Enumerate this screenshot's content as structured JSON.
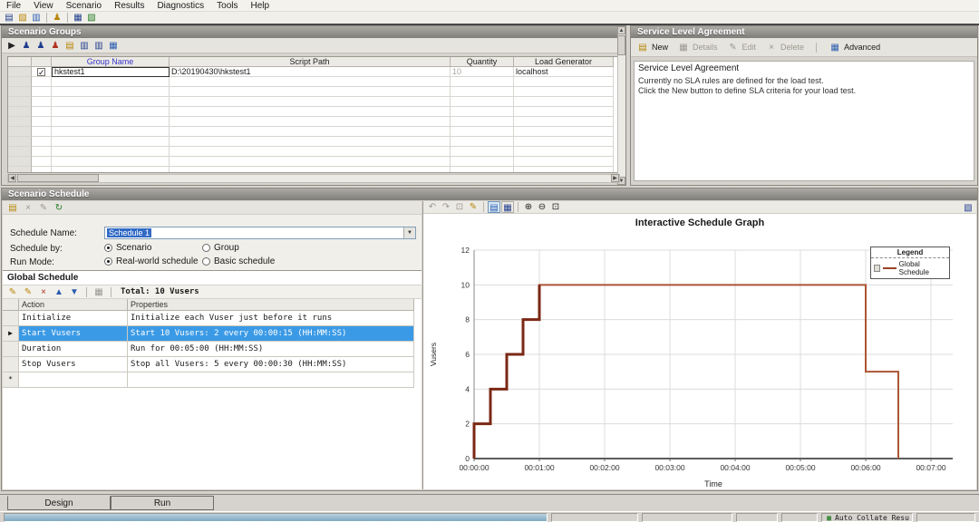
{
  "menu": {
    "items": [
      "File",
      "View",
      "Scenario",
      "Results",
      "Diagnostics",
      "Tools",
      "Help"
    ]
  },
  "icons": {
    "new_scenario": "▤",
    "open": "▨",
    "save": "▥",
    "vusers": "♟",
    "results_grid": "▦",
    "diagnostics": "▧",
    "play": "▶",
    "add_group": "♟",
    "script_page": "▤",
    "duplicate": "▥",
    "generators": "▦",
    "pencil": "✎",
    "cross": "×",
    "up": "▲",
    "down": "▼",
    "undo": "↶",
    "redo": "↷",
    "zoom_in": "⊕",
    "zoom_out": "⊖",
    "zoom_fit": "⊡",
    "refresh": "↻",
    "dropdown": "▼",
    "left_arrow": "◀",
    "right_arrow": "▶",
    "check": "✓",
    "row_marker": "▶",
    "chart_view": "▤",
    "grid_view": "▦"
  },
  "scenario_groups": {
    "title": "Scenario Groups",
    "columns": [
      "Group Name",
      "Script Path",
      "Quantity",
      "Load Generator"
    ],
    "rows": [
      {
        "checked": true,
        "group_name": "hkstest1",
        "script_path": "D:\\20190430\\hkstest1",
        "quantity": "10",
        "load_generator": "localhost"
      }
    ],
    "empty_row_count": 10
  },
  "sla": {
    "title": "Service Level Agreement",
    "toolbar": {
      "new": "New",
      "details": "Details",
      "edit": "Edit",
      "delete": "Delete",
      "advanced": "Advanced"
    },
    "heading": "Service Level Agreement",
    "message_line1": "Currently no SLA rules are defined for the load test.",
    "message_line2": "Click the New button to define SLA criteria for your load test."
  },
  "scenario_schedule": {
    "title": "Scenario Schedule",
    "schedule_name_label": "Schedule Name:",
    "schedule_name_value": "Schedule 1",
    "schedule_by_label": "Schedule by:",
    "schedule_by_options": [
      {
        "label": "Scenario",
        "selected": true
      },
      {
        "label": "Group",
        "selected": false
      }
    ],
    "run_mode_label": "Run Mode:",
    "run_mode_options": [
      {
        "label": "Real-world schedule",
        "selected": true
      },
      {
        "label": "Basic schedule",
        "selected": false
      }
    ]
  },
  "global_schedule": {
    "title": "Global Schedule",
    "total_label": "Total: 10 Vusers",
    "columns": [
      "Action",
      "Properties"
    ],
    "rows": [
      {
        "action": "Initialize",
        "properties": "Initialize each Vuser just before it runs",
        "selected": false
      },
      {
        "action": "Start Vusers",
        "properties": "Start 10 Vusers: 2 every 00:00:15 (HH:MM:SS)",
        "selected": true
      },
      {
        "action": "Duration",
        "properties": "Run for 00:05:00 (HH:MM:SS)",
        "selected": false
      },
      {
        "action": "Stop Vusers",
        "properties": "Stop all Vusers: 5 every 00:00:30 (HH:MM:SS)",
        "selected": false
      }
    ],
    "new_row_marker": "*"
  },
  "chart_data": {
    "type": "line",
    "title": "Interactive Schedule Graph",
    "xlabel": "Time",
    "ylabel": "Vusers",
    "ylim": [
      0,
      12
    ],
    "y_ticks": [
      0,
      2,
      4,
      6,
      8,
      10,
      12
    ],
    "x_ticks": [
      {
        "sec": 0,
        "label": "00:00:00"
      },
      {
        "sec": 60,
        "label": "00:01:00"
      },
      {
        "sec": 120,
        "label": "00:02:00"
      },
      {
        "sec": 180,
        "label": "00:03:00"
      },
      {
        "sec": 240,
        "label": "00:04:00"
      },
      {
        "sec": 300,
        "label": "00:05:00"
      },
      {
        "sec": 360,
        "label": "00:06:00"
      },
      {
        "sec": 420,
        "label": "00:07:00"
      }
    ],
    "x_max_sec": 440,
    "grid": true,
    "legend": {
      "title": "Legend",
      "position": "top-right",
      "entries": [
        {
          "label": "Global Schedule",
          "color": "#9c4026"
        }
      ]
    },
    "series": [
      {
        "name": "Global Schedule",
        "color": "#ad5634",
        "ramp_color": "#7b2815",
        "ramp_until_sec": 60,
        "points": [
          [
            0,
            0
          ],
          [
            0,
            2
          ],
          [
            15,
            2
          ],
          [
            15,
            4
          ],
          [
            30,
            4
          ],
          [
            30,
            6
          ],
          [
            45,
            6
          ],
          [
            45,
            8
          ],
          [
            60,
            8
          ],
          [
            60,
            10
          ],
          [
            360,
            10
          ],
          [
            360,
            5
          ],
          [
            390,
            5
          ],
          [
            390,
            0
          ]
        ]
      }
    ]
  },
  "tabs": {
    "items": [
      {
        "label": "Design",
        "active": true
      },
      {
        "label": "Run",
        "active": false
      }
    ]
  },
  "status_bar": {
    "auto_collate": "Auto Collate Resu"
  }
}
